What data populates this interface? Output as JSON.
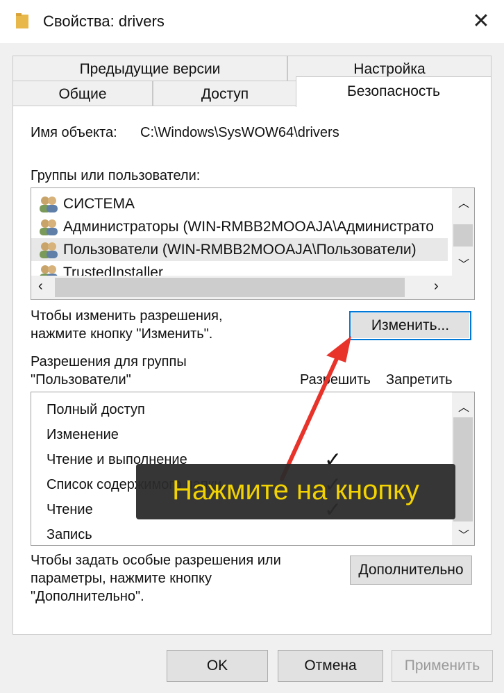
{
  "window": {
    "title": "Свойства: drivers",
    "close_glyph": "✕"
  },
  "tabs": {
    "row1": [
      {
        "label": "Предыдущие версии"
      },
      {
        "label": "Настройка"
      }
    ],
    "row2": [
      {
        "label": "Общие"
      },
      {
        "label": "Доступ"
      },
      {
        "label": "Безопасность"
      }
    ]
  },
  "security": {
    "object_label": "Имя объекта:",
    "object_path": "C:\\Windows\\SysWOW64\\drivers",
    "groups_label": "Группы или пользователи:",
    "users": [
      {
        "name": "СИСТЕМА"
      },
      {
        "name": "Администраторы (WIN-RMBB2MOOAJA\\Администрато"
      },
      {
        "name": "Пользователи (WIN-RMBB2MOOAJA\\Пользователи)"
      },
      {
        "name": "TrustedInstaller"
      }
    ],
    "change_hint_1": "Чтобы изменить разрешения,",
    "change_hint_2": "нажмите кнопку \"Изменить\".",
    "change_button": "Изменить...",
    "perm_label_1": "Разрешения для группы",
    "perm_label_2": "\"Пользователи\"",
    "col_allow": "Разрешить",
    "col_deny": "Запретить",
    "permissions": [
      {
        "name": "Полный доступ",
        "allow": false
      },
      {
        "name": "Изменение",
        "allow": false
      },
      {
        "name": "Чтение и выполнение",
        "allow": true
      },
      {
        "name": "Список содержимого папки",
        "allow": true
      },
      {
        "name": "Чтение",
        "allow": true
      },
      {
        "name": "Запись",
        "allow": false
      }
    ],
    "adv_hint_1": "Чтобы задать особые разрешения или",
    "adv_hint_2": "параметры, нажмите кнопку",
    "adv_hint_3": "\"Дополнительно\".",
    "advanced_button": "Дополнительно"
  },
  "overlay": {
    "text": "Нажмите на кнопку",
    "color": "#f2d200",
    "arrow_color": "#e8332a"
  },
  "footer": {
    "ok": "OK",
    "cancel": "Отмена",
    "apply": "Применить"
  }
}
